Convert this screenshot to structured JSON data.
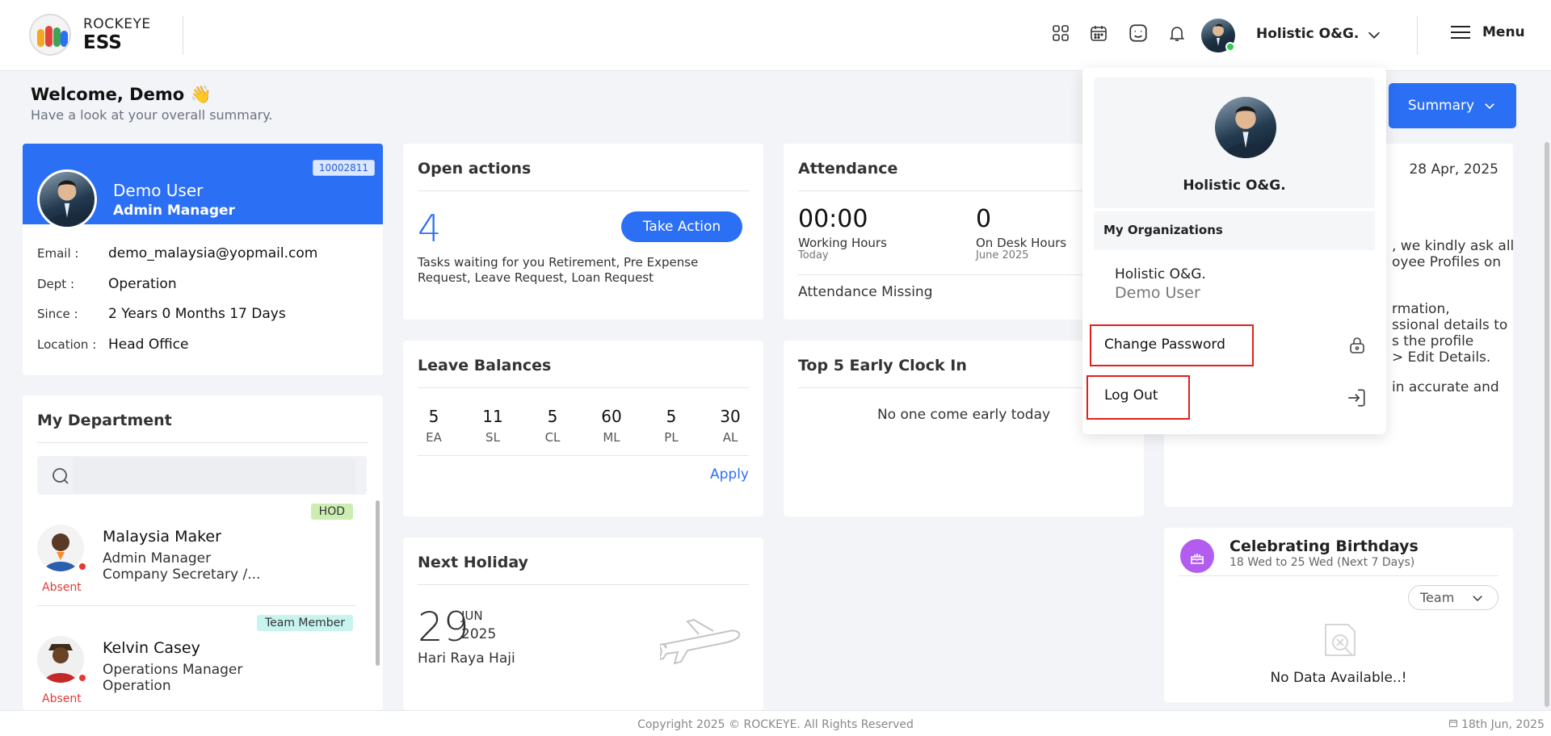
{
  "header": {
    "brand_line1": "ROCKEYE",
    "brand_line2": "ESS",
    "icons": [
      "apps-grid-icon",
      "calendar-icon",
      "emoji-face-icon",
      "bell-icon"
    ],
    "org_name": "Holistic O&G.",
    "menu_label": "Menu"
  },
  "welcome": {
    "title": "Welcome, Demo 👋",
    "subtitle": "Have a look at your overall summary.",
    "summary_button": "Summary"
  },
  "profile": {
    "employee_id": "10002811",
    "name": "Demo User",
    "role": "Admin Manager",
    "fields": [
      {
        "label": "Email :",
        "value": "demo_malaysia@yopmail.com"
      },
      {
        "label": "Dept :",
        "value": "Operation"
      },
      {
        "label": "Since :",
        "value": "2 Years 0 Months 17 Days"
      },
      {
        "label": "Location :",
        "value": "Head Office"
      }
    ]
  },
  "department": {
    "title": "My Department",
    "search_placeholder": "",
    "members": [
      {
        "name": "Malaysia Maker",
        "line1": "Admin Manager",
        "line2": "Company Secretary /...",
        "tag": "HOD",
        "status": "Absent"
      },
      {
        "name": "Kelvin Casey",
        "line1": "Operations Manager",
        "line2": "Operation",
        "tag": "Team Member",
        "status": "Absent"
      }
    ]
  },
  "open_actions": {
    "title": "Open actions",
    "count": "4",
    "button": "Take Action",
    "description": "Tasks waiting for you Retirement, Pre Expense Request, Leave Request, Loan Request"
  },
  "attendance": {
    "title": "Attendance",
    "working_hours": "00:00",
    "working_hours_label": "Working Hours",
    "working_hours_sub": "Today",
    "desk_hours": "0",
    "desk_hours_label": "On Desk Hours",
    "desk_hours_sub": "June 2025",
    "missing_label": "Attendance Missing"
  },
  "leave_balances": {
    "title": "Leave Balances",
    "items": [
      {
        "value": "5",
        "code": "EA"
      },
      {
        "value": "11",
        "code": "SL"
      },
      {
        "value": "5",
        "code": "CL"
      },
      {
        "value": "60",
        "code": "ML"
      },
      {
        "value": "5",
        "code": "PL"
      },
      {
        "value": "30",
        "code": "AL"
      }
    ],
    "apply_label": "Apply"
  },
  "early_clock": {
    "title": "Top 5 Early Clock In",
    "empty_text": "No one come early today"
  },
  "holiday": {
    "title": "Next Holiday",
    "day": "29",
    "month": "JUN",
    "year": "2025",
    "name": "Hari Raya Haji"
  },
  "announcement": {
    "date": "28 Apr, 2025",
    "lines": [
      ", we kindly ask all",
      "oyee Profiles on",
      "rmation,",
      "ssional details to",
      "s the profile",
      "> Edit Details.",
      "in accurate and"
    ]
  },
  "birthdays": {
    "title": "Celebrating Birthdays",
    "subtitle": "18 Wed to 25 Wed (Next 7 Days)",
    "filter": "Team",
    "empty_text": "No Data Available..!"
  },
  "dropdown": {
    "user_name": "Holistic O&G.",
    "org_section": "My Organizations",
    "org_name": "Holistic O&G.",
    "org_user": "Demo User",
    "change_password": "Change Password",
    "logout": "Log Out"
  },
  "footer": {
    "copyright": "Copyright 2025 © ROCKEYE. All Rights Reserved",
    "date": "18th Jun, 2025"
  },
  "colors": {
    "primary": "#2b6ff5",
    "absent": "#e53935",
    "hod_tag": "#cdeeb3",
    "team_tag": "#c7f4ef",
    "highlight_box": "#e0201b"
  }
}
